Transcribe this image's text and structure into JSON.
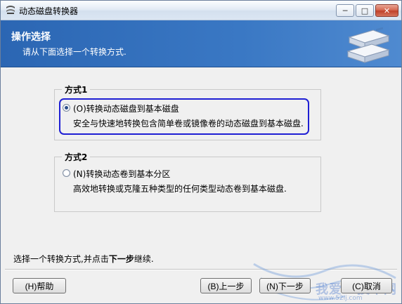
{
  "window": {
    "title": "动态磁盘转换器",
    "controls": {
      "minimize": "─",
      "maximize": "□",
      "close": "✕"
    }
  },
  "header": {
    "title": "操作选择",
    "subtitle": "请从下面选择一个转换方式."
  },
  "options": [
    {
      "group_label": "方式1",
      "label": "(O)转换动态磁盘到基本磁盘",
      "description": "安全与快速地转换包含简单卷或镜像卷的动态磁盘到基本磁盘.",
      "checked": true
    },
    {
      "group_label": "方式2",
      "label": "(N)转换动态卷到基本分区",
      "description": "高效地转换或克隆五种类型的任何类型动态卷到基本磁盘.",
      "checked": false
    }
  ],
  "status": {
    "prefix": "选择一个转换方式,并点击",
    "bold": "下一步",
    "suffix": "继续."
  },
  "buttons": {
    "help": "(H)帮助",
    "prev": "(B)上一步",
    "next": "(N)下一步",
    "cancel": "(C)取消"
  },
  "watermark": {
    "text": "我爱IT技术网",
    "url": "www.52ij.com"
  },
  "colors": {
    "header_blue": "#2b66b3",
    "focus_ring": "#1f1fd4",
    "close_red": "#c0412a"
  }
}
